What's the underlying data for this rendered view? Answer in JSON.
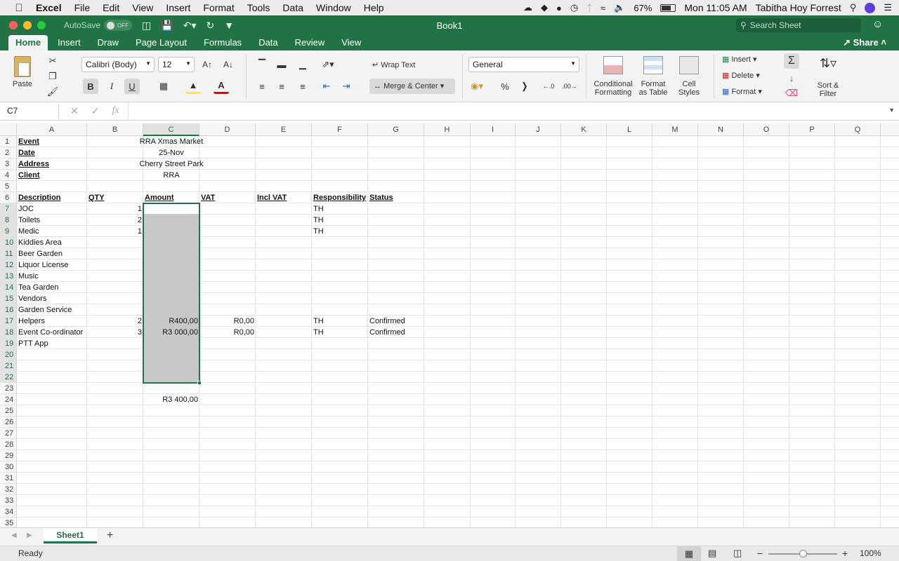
{
  "menubar": {
    "app": "Excel",
    "items": [
      "File",
      "Edit",
      "View",
      "Insert",
      "Format",
      "Tools",
      "Data",
      "Window",
      "Help"
    ],
    "battery": "67%",
    "clock": "Mon 11:05 AM",
    "user": "Tabitha Hoy Forrest"
  },
  "titlebar": {
    "autosave_label": "AutoSave",
    "autosave_state": "OFF",
    "title": "Book1",
    "search_placeholder": "Search Sheet"
  },
  "ribbon_tabs": [
    "Home",
    "Insert",
    "Draw",
    "Page Layout",
    "Formulas",
    "Data",
    "Review",
    "View"
  ],
  "share_label": "Share",
  "ribbon": {
    "paste": "Paste",
    "font_name": "Calibri (Body)",
    "font_size": "12",
    "wrap_text": "Wrap Text",
    "merge_center": "Merge & Center",
    "number_format": "General",
    "conditional_1": "Conditional",
    "conditional_2": "Formatting",
    "format_table_1": "Format",
    "format_table_2": "as Table",
    "cell_styles_1": "Cell",
    "cell_styles_2": "Styles",
    "insert": "Insert",
    "delete": "Delete",
    "format": "Format",
    "sort_1": "Sort &",
    "sort_2": "Filter",
    "bold": "B",
    "italic": "I",
    "underline": "U",
    "percent": "%",
    "inc_font": "A↑",
    "dec_font": "A↓"
  },
  "formula_bar": {
    "name_box": "C7",
    "fx": "fx",
    "value": ""
  },
  "columns": [
    "A",
    "B",
    "C",
    "D",
    "E",
    "F",
    "G",
    "H",
    "I",
    "J",
    "K",
    "L",
    "M",
    "N",
    "O",
    "P",
    "Q"
  ],
  "rows": [
    "1",
    "2",
    "3",
    "4",
    "5",
    "6",
    "7",
    "8",
    "9",
    "10",
    "11",
    "12",
    "13",
    "14",
    "15",
    "16",
    "17",
    "18",
    "19",
    "20",
    "21",
    "22",
    "23",
    "24",
    "25",
    "26",
    "27",
    "28",
    "29",
    "30",
    "31",
    "32",
    "33",
    "34",
    "35"
  ],
  "header_block": {
    "event_label": "Event",
    "event_value": "RRA Xmas Market",
    "date_label": "Date",
    "date_value": "25-Nov",
    "address_label": "Address",
    "address_value": "Cherry Street Park",
    "client_label": "Client",
    "client_value": "RRA"
  },
  "table_headers": [
    "Description",
    "QTY",
    "Amount",
    "VAT",
    "Incl VAT",
    "Responsibility",
    "Status"
  ],
  "table_rows": [
    {
      "row": 7,
      "desc": "JOC",
      "qty": "1",
      "amount": "",
      "vat": "",
      "resp": "TH",
      "status": ""
    },
    {
      "row": 8,
      "desc": "Toilets",
      "qty": "2",
      "amount": "",
      "vat": "",
      "resp": "TH",
      "status": ""
    },
    {
      "row": 9,
      "desc": "Medic",
      "qty": "1",
      "amount": "",
      "vat": "",
      "resp": "TH",
      "status": ""
    },
    {
      "row": 10,
      "desc": "Kiddies Area",
      "qty": "",
      "amount": "",
      "vat": "",
      "resp": "",
      "status": ""
    },
    {
      "row": 11,
      "desc": "Beer Garden",
      "qty": "",
      "amount": "",
      "vat": "",
      "resp": "",
      "status": ""
    },
    {
      "row": 12,
      "desc": "Liquor License",
      "qty": "",
      "amount": "",
      "vat": "",
      "resp": "",
      "status": ""
    },
    {
      "row": 13,
      "desc": "Music",
      "qty": "",
      "amount": "",
      "vat": "",
      "resp": "",
      "status": ""
    },
    {
      "row": 14,
      "desc": "Tea Garden",
      "qty": "",
      "amount": "",
      "vat": "",
      "resp": "",
      "status": ""
    },
    {
      "row": 15,
      "desc": "Vendors",
      "qty": "",
      "amount": "",
      "vat": "",
      "resp": "",
      "status": ""
    },
    {
      "row": 16,
      "desc": "Garden Service",
      "qty": "",
      "amount": "",
      "vat": "",
      "resp": "",
      "status": ""
    },
    {
      "row": 17,
      "desc": "Helpers",
      "qty": "2",
      "amount": "R400,00",
      "vat": "R0,00",
      "resp": "TH",
      "status": "Confirmed"
    },
    {
      "row": 18,
      "desc": "Event Co-ordinator",
      "qty": "3",
      "amount": "R3 000,00",
      "vat": "R0,00",
      "resp": "TH",
      "status": "Confirmed"
    },
    {
      "row": 19,
      "desc": "PTT App",
      "qty": "",
      "amount": "",
      "vat": "",
      "resp": "",
      "status": ""
    }
  ],
  "total_amount": "R3 400,00",
  "sheet_tab": "Sheet1",
  "status": {
    "ready": "Ready",
    "zoom": "100%"
  }
}
